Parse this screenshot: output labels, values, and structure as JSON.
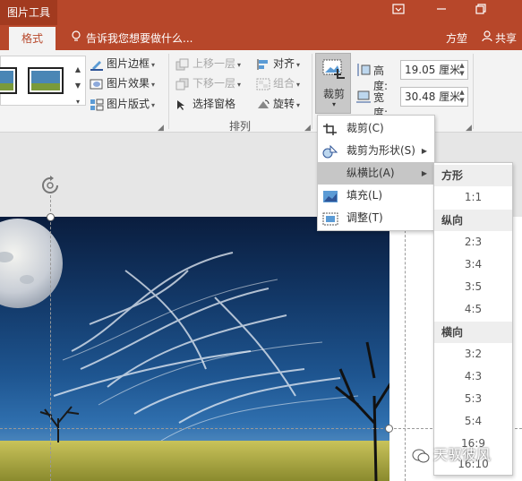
{
  "app": {
    "context_tab": "图片工具",
    "active_tab": "格式",
    "tell_me": "告诉我您想要做什么...",
    "user": "方堃",
    "share": "共享",
    "window_controls": [
      "ribbon-display-icon",
      "minimize-icon",
      "restore-icon"
    ]
  },
  "ribbon": {
    "picture_styles": {
      "border": "图片边框",
      "effects": "图片效果",
      "layout": "图片版式"
    },
    "arrange": {
      "bring_forward": "上移一层",
      "send_backward": "下移一层",
      "selection_pane": "选择窗格",
      "align": "对齐",
      "group": "组合",
      "rotate": "旋转",
      "group_label": "排列"
    },
    "crop_button": "裁剪",
    "size": {
      "height_label": "高度:",
      "height_value": "19.05 厘米",
      "width_label": "宽度:",
      "width_value": "30.48 厘米"
    }
  },
  "crop_menu": {
    "items": [
      {
        "label": "裁剪(C)",
        "icon": "crop-icon"
      },
      {
        "label": "裁剪为形状(S)",
        "icon": "shapes-icon",
        "has_submenu": true
      },
      {
        "label": "纵横比(A)",
        "icon": "",
        "has_submenu": true,
        "highlighted": true
      },
      {
        "label": "填充(L)",
        "icon": "fill-icon"
      },
      {
        "label": "调整(T)",
        "icon": "fit-icon"
      }
    ]
  },
  "aspect_submenu": {
    "square_header": "方形",
    "square": [
      "1:1"
    ],
    "portrait_header": "纵向",
    "portrait": [
      "2:3",
      "3:4",
      "3:5",
      "4:5"
    ],
    "landscape_header": "横向",
    "landscape": [
      "3:2",
      "4:3",
      "5:3",
      "5:4",
      "16:9",
      "16:10"
    ]
  },
  "watermark": "天驭彼风",
  "colors": {
    "title_bar": "#b7472a",
    "ribbon": "#f3f3f3",
    "menu_highlight": "#c6c6c6"
  }
}
